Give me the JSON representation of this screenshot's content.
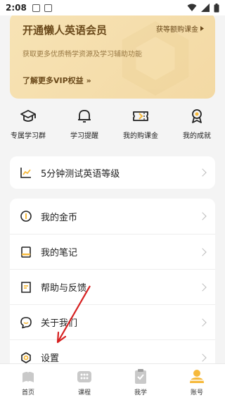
{
  "status_bar": {
    "time": "2:08"
  },
  "vip": {
    "title": "开通懒人英语会员",
    "trial": "获等额购课金",
    "desc": "获取更多优质畅学资源及学习辅助功能",
    "more": "了解更多VIP权益",
    "more_arrows": "»"
  },
  "quick": [
    {
      "label": "专属学习群",
      "icon": "graduation-cap-icon"
    },
    {
      "label": "学习提醒",
      "icon": "bell-icon"
    },
    {
      "label": "我的购课金",
      "icon": "ticket-icon"
    },
    {
      "label": "我的成就",
      "icon": "medal-icon"
    }
  ],
  "test": {
    "label": "5分钟测试英语等级"
  },
  "menu": [
    {
      "label": "我的金币",
      "icon": "coin-icon"
    },
    {
      "label": "我的笔记",
      "icon": "notebook-icon"
    },
    {
      "label": "帮助与反馈",
      "icon": "feedback-icon"
    },
    {
      "label": "关于我们",
      "icon": "chat-icon"
    },
    {
      "label": "设置",
      "icon": "settings-icon"
    }
  ],
  "tabs": [
    {
      "label": "首页",
      "icon": "home-icon"
    },
    {
      "label": "课程",
      "icon": "courses-icon"
    },
    {
      "label": "我学",
      "icon": "clipboard-icon"
    },
    {
      "label": "账号",
      "icon": "account-icon",
      "active": true
    }
  ],
  "colors": {
    "vip_gold": "#f3d9a4",
    "annotation_red": "#d62020",
    "accent_yellow": "#f6b93b"
  }
}
